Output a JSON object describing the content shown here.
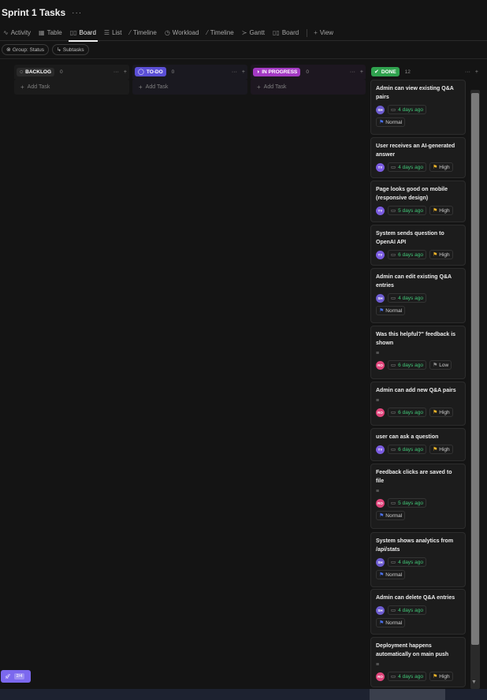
{
  "header": {
    "title": "Sprint 1 Tasks",
    "more": "···"
  },
  "tabs": [
    {
      "icon": "∿",
      "label": "Activity"
    },
    {
      "icon": "▦",
      "label": "Table"
    },
    {
      "icon": "▯▯",
      "label": "Board"
    },
    {
      "icon": "☰",
      "label": "List"
    },
    {
      "icon": "⁄",
      "label": "Timeline"
    },
    {
      "icon": "◷",
      "label": "Workload"
    },
    {
      "icon": "⁄",
      "label": "Timeline"
    },
    {
      "icon": "≻",
      "label": "Gantt"
    },
    {
      "icon": "▯▯",
      "label": "Board"
    },
    {
      "icon": "+",
      "label": "View"
    }
  ],
  "filters": {
    "group": "Group: Status",
    "subtasks": "Subtasks"
  },
  "columns": [
    {
      "name": "BACKLOG",
      "count": "0",
      "color": "#2a2a2a",
      "add": "Add Task"
    },
    {
      "name": "TO-DO",
      "count": "0",
      "color": "#5b4fd6",
      "add": "Add Task"
    },
    {
      "name": "IN PROGRESS",
      "count": "0",
      "color": "#a43ac4",
      "add": "Add Task"
    },
    {
      "name": "DONE",
      "count": "12",
      "color": "#2fa24e"
    }
  ],
  "cards": [
    {
      "title": "Admin can view existing Q&A pairs",
      "avatar": "SH",
      "avatar_color": "#6c5bd0",
      "date": "4 days ago",
      "priority": "Normal",
      "prio_color": "#4a6fe8"
    },
    {
      "title": "User receives an AI-generated answer",
      "avatar": "TY",
      "avatar_color": "#7a5be0",
      "date": "4 days ago",
      "priority": "High",
      "prio_color": "#f0b429"
    },
    {
      "title": "Page looks good on mobile (responsive design)",
      "avatar": "TY",
      "avatar_color": "#7a5be0",
      "date": "5 days ago",
      "priority": "High",
      "prio_color": "#f0b429"
    },
    {
      "title": "System sends question to OpenAI API",
      "avatar": "TY",
      "avatar_color": "#7a5be0",
      "date": "6 days ago",
      "priority": "High",
      "prio_color": "#f0b429"
    },
    {
      "title": "Admin can edit existing Q&A entries",
      "avatar": "SH",
      "avatar_color": "#6c5bd0",
      "date": "4 days ago",
      "priority": "Normal",
      "prio_color": "#4a6fe8"
    },
    {
      "title": "Was this helpful?\" feedback is shown",
      "avatar": "RO",
      "avatar_color": "#e0457b",
      "date": "6 days ago",
      "priority": "Low",
      "prio_color": "#8a8a8a"
    },
    {
      "title": "Admin can add new Q&A pairs",
      "avatar": "RO",
      "avatar_color": "#e0457b",
      "date": "6 days ago",
      "priority": "High",
      "prio_color": "#f0b429"
    },
    {
      "title": "user can ask a question",
      "avatar": "TY",
      "avatar_color": "#7a5be0",
      "date": "6 days ago",
      "priority": "High",
      "prio_color": "#f0b429"
    },
    {
      "title": "Feedback clicks are saved to file",
      "avatar": "RO",
      "avatar_color": "#e0457b",
      "date": "5 days ago",
      "priority": "Normal",
      "prio_color": "#4a6fe8"
    },
    {
      "title": "System shows analytics from /api/stats",
      "avatar": "SH",
      "avatar_color": "#6c5bd0",
      "date": "4 days ago",
      "priority": "Normal",
      "prio_color": "#4a6fe8"
    },
    {
      "title": "Admin can delete Q&A entries",
      "avatar": "SH",
      "avatar_color": "#6c5bd0",
      "date": "4 days ago",
      "priority": "Normal",
      "prio_color": "#4a6fe8"
    },
    {
      "title": "Deployment happens automatically on main push",
      "avatar": "RO",
      "avatar_color": "#e0457b",
      "date": "4 days ago",
      "priority": "High",
      "prio_color": "#f0b429"
    }
  ],
  "rocket": {
    "badge": "2/4"
  },
  "icons": {
    "more": "more-horizontal-icon",
    "plus": "plus-icon",
    "calendar": "calendar-icon",
    "flag": "flag-icon",
    "description": "description-icon",
    "rocket": "rocket-icon"
  }
}
